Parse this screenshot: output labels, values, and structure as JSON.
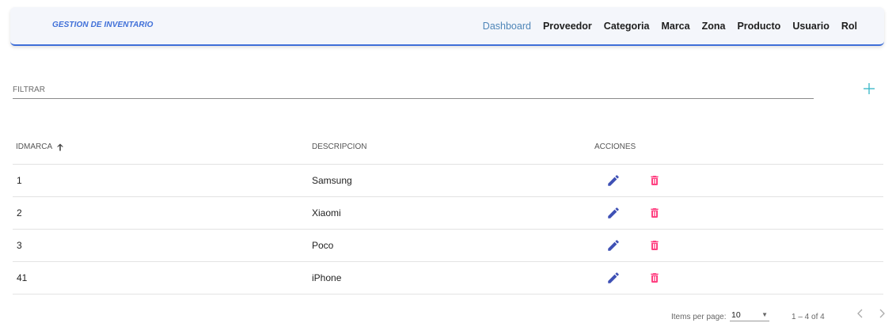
{
  "header": {
    "brand": "GESTION DE INVENTARIO",
    "nav": [
      {
        "label": "Dashboard",
        "active": true
      },
      {
        "label": "Proveedor"
      },
      {
        "label": "Categoria"
      },
      {
        "label": "Marca"
      },
      {
        "label": "Zona"
      },
      {
        "label": "Producto"
      },
      {
        "label": "Usuario"
      },
      {
        "label": "Rol"
      }
    ]
  },
  "filter": {
    "placeholder": "FILTRAR",
    "value": ""
  },
  "add_icon": "plus-icon",
  "table": {
    "columns": [
      "IDMARCA",
      "DESCRIPCION",
      "ACCIONES"
    ],
    "sort_icon": "arrow-up-icon",
    "rows": [
      {
        "id": "1",
        "descripcion": "Samsung"
      },
      {
        "id": "2",
        "descripcion": "Xiaomi"
      },
      {
        "id": "3",
        "descripcion": "Poco"
      },
      {
        "id": "41",
        "descripcion": "iPhone"
      }
    ],
    "action_icons": [
      "edit-icon",
      "delete-icon"
    ]
  },
  "paginator": {
    "items_label": "Items per page:",
    "page_size": "10",
    "range": "1 – 4 of 4",
    "prev_icon": "chevron-left-icon",
    "next_icon": "chevron-right-icon"
  },
  "colors": {
    "brand": "#3f6fd8",
    "active_nav": "#4f86b8",
    "add": "#33b5c5",
    "edit": "#3f51b5",
    "delete": "#ff4081"
  }
}
